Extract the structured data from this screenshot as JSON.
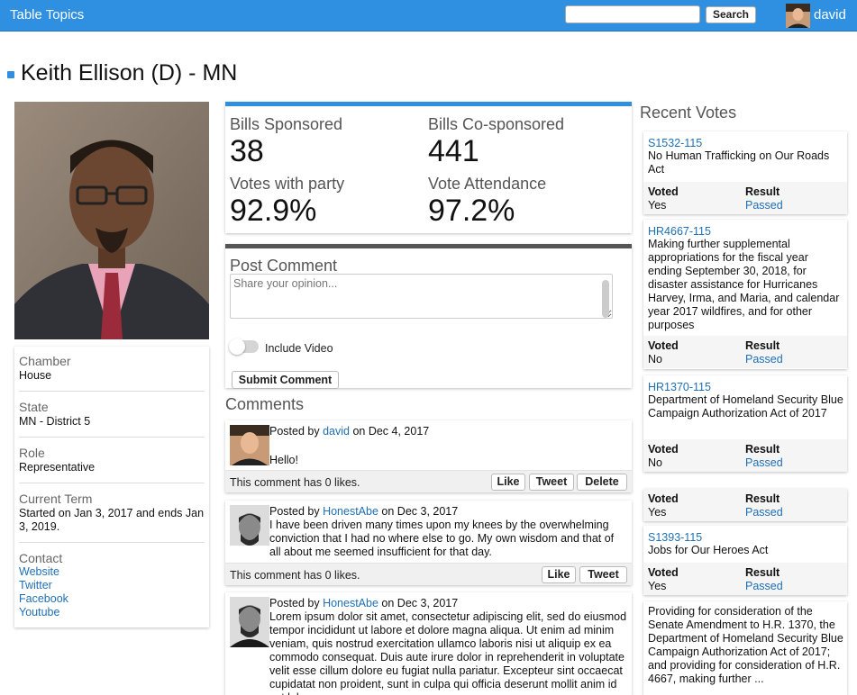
{
  "header": {
    "brand": "Table Topics",
    "search_placeholder": "",
    "search_button": "Search",
    "user_name": "david"
  },
  "page_title": "Keith Ellison (D) - MN",
  "info": {
    "chamber_label": "Chamber",
    "chamber_value": "House",
    "state_label": "State",
    "state_value": "MN - District 5",
    "role_label": "Role",
    "role_value": "Representative",
    "term_label": "Current Term",
    "term_value": "Started on Jan 3, 2017 and ends Jan 3, 2019.",
    "contact_label": "Contact",
    "links": [
      "Website",
      "Twitter",
      "Facebook",
      "Youtube"
    ]
  },
  "stats": {
    "bills_sponsored_label": "Bills Sponsored",
    "bills_sponsored_value": "38",
    "cosponsored_label": "Bills Co-sponsored",
    "cosponsored_value": "441",
    "party_label": "Votes with party",
    "party_value": "92.9%",
    "attendance_label": "Vote Attendance",
    "attendance_value": "97.2%"
  },
  "post_comment": {
    "title": "Post Comment",
    "placeholder": "Share your opinion...",
    "include_video": "Include Video",
    "submit": "Submit Comment"
  },
  "comments_title": "Comments",
  "comments": [
    {
      "prefix": "Posted by",
      "author": "david",
      "date": "on Dec 4, 2017",
      "body": "Hello!",
      "likes": "This comment has 0 likes.",
      "like": "Like",
      "tweet": "Tweet",
      "delete": "Delete"
    },
    {
      "prefix": "Posted by",
      "author": "HonestAbe",
      "date": "on Dec 3, 2017",
      "body": "I have been driven many times upon my knees by the overwhelming conviction that I had no where else to go. My own wisdom and that of all about me seemed insufficient for that day.",
      "likes": "This comment has 0 likes.",
      "like": "Like",
      "tweet": "Tweet"
    },
    {
      "prefix": "Posted by",
      "author": "HonestAbe",
      "date": "on Dec 3, 2017",
      "body": "Lorem ipsum dolor sit amet, consectetur adipiscing elit, sed do eiusmod tempor incididunt ut labore et dolore magna aliqua. Ut enim ad minim veniam, quis nostrud exercitation ullamco laboris nisi ut aliquip ex ea commodo consequat. Duis aute irure dolor in reprehenderit in voluptate velit esse cillum dolore eu fugiat nulla pariatur. Excepteur sint occaecat cupidatat non proident, sunt in culpa qui officia deserunt mollit anim id est laborum."
    }
  ],
  "recent_votes": {
    "title": "Recent Votes",
    "voted_label": "Voted",
    "result_label": "Result",
    "items": [
      {
        "id": "S1532-115",
        "desc": "No Human Trafficking on Our Roads Act",
        "voted": "Yes",
        "result": "Passed"
      },
      {
        "id": "HR4667-115",
        "desc": "Making further supplemental appropriations for the fiscal year ending September 30, 2018, for disaster assistance for Hurricanes Harvey, Irma, and Maria, and calendar year 2017 wildfires, and for other purposes",
        "voted": "No",
        "result": "Passed"
      },
      {
        "id": "HR1370-115",
        "desc": "Department of Homeland Security Blue Campaign Authorization Act of 2017",
        "voted": "No",
        "result": "Passed"
      },
      {
        "id": "",
        "desc": "",
        "voted": "Yes",
        "result": "Passed"
      },
      {
        "id": "S1393-115",
        "desc": "Jobs for Our Heroes Act",
        "voted": "Yes",
        "result": "Passed"
      },
      {
        "id": "",
        "desc": "Providing for consideration of the Senate Amendment to H.R. 1370, the Department of Homeland Security Blue Campaign Authorization Act of 2017; and providing for consideration of H.R. 4667, making further ...",
        "voted": "",
        "result": ""
      }
    ]
  }
}
